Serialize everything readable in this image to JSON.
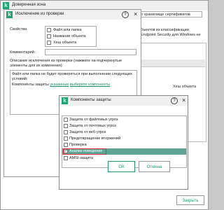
{
  "trusted_zone": {
    "title": "Доверенная зона",
    "tab_certificates": "ю хранилище сертификатов",
    "text_line1": "бъектов из классификации",
    "text_line2": "Endpoint Security для Windows не",
    "col_hash": "Хеш объекта",
    "ok_label": "ОК",
    "close_label": "Закрыть"
  },
  "exclusion_dialog": {
    "title": "Исключение из проверки",
    "properties_label": "Свойства",
    "properties": [
      {
        "label": "Файл или папка",
        "checked": false
      },
      {
        "label": "Название объекта",
        "checked": false
      },
      {
        "label": "Хеш объекта",
        "checked": false
      }
    ],
    "comment_label": "Комментарий:",
    "description_label": "Описание исключения из проверки (нажмите на подчеркнутые элементы для их изменения):",
    "desc_line1": "Файл или папка не будет проверяться при выполнении следующих",
    "desc_line2": "условий:",
    "components_prefix": "Компоненты защиты",
    "link_specified": "указанные",
    "link_select": "выберите компоненты"
  },
  "components_dialog": {
    "title": "Компоненты защиты",
    "items": [
      {
        "label": "Защита от файловых угроз",
        "checked": false,
        "selected": false
      },
      {
        "label": "Защита от почтовых угроз",
        "checked": false,
        "selected": false
      },
      {
        "label": "Защита от веб-угроз",
        "checked": false,
        "selected": false
      },
      {
        "label": "Предотвращение вторжений",
        "checked": false,
        "selected": false
      },
      {
        "label": "Проверка",
        "checked": false,
        "selected": false
      },
      {
        "label": "Анализ поведения",
        "checked": true,
        "selected": true
      },
      {
        "label": "AMSI-защита",
        "checked": false,
        "selected": false
      }
    ],
    "ok_label": "ОК",
    "cancel_label": "Отмена"
  },
  "colors": {
    "accent": "#1a9a6a",
    "selected_row": "#5fa595",
    "highlight_box": "#d9363e"
  }
}
